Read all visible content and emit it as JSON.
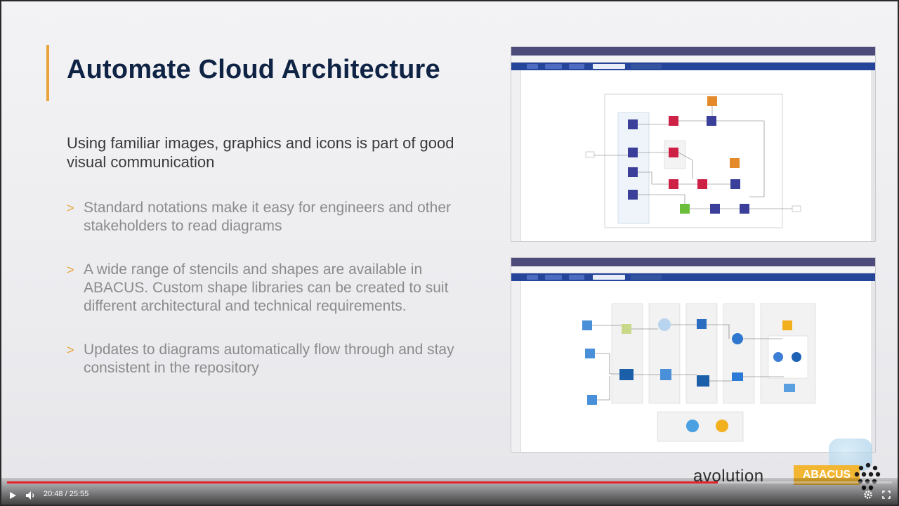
{
  "slide": {
    "title": "Automate Cloud Architecture",
    "intro": "Using familiar images, graphics and icons is part of good visual communication",
    "bullets": [
      "Standard notations make it easy for engineers and other stakeholders to read diagrams",
      "A wide range of stencils and shapes are available in ABACUS. Custom shape libraries can be created to suit different architectural and technical requirements.",
      "Updates to diagrams automatically flow through and stay consistent in the repository"
    ],
    "bullet_marker": ">"
  },
  "branding": {
    "word": "avolution",
    "badge": "ABACUS",
    "badge_color": "#f2b632"
  },
  "player": {
    "time": "20:48 / 25:55",
    "progress": 0.803,
    "progress_color": "#e3222b",
    "icons": [
      "play-icon",
      "volume-icon",
      "settings-icon",
      "fullscreen-icon"
    ]
  },
  "colors": {
    "title": "#0f2344",
    "accent": "#e8a33a",
    "toolbar": "#25459b"
  }
}
